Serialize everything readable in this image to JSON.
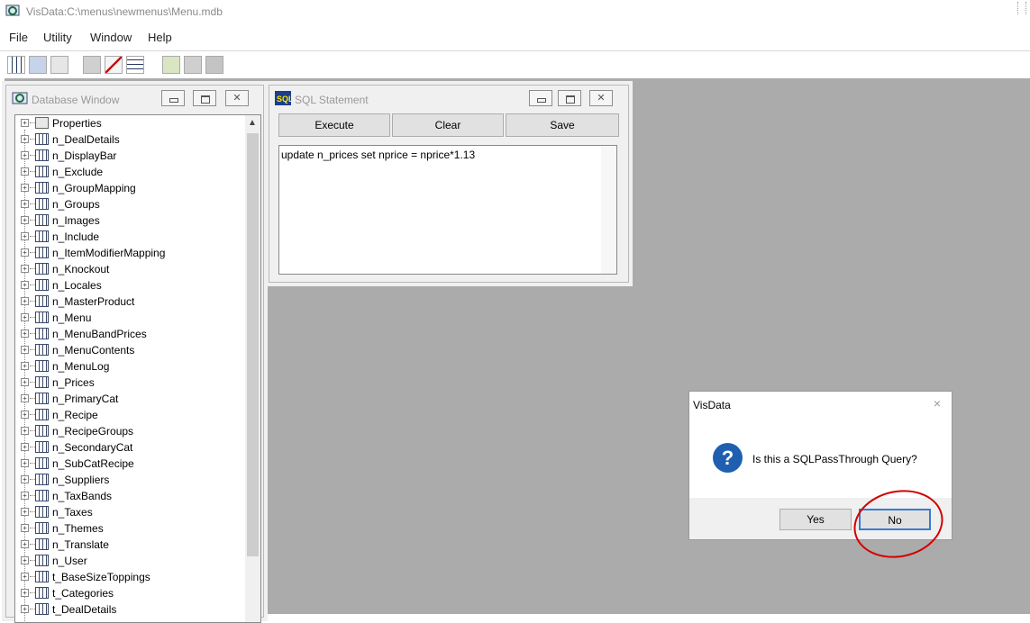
{
  "app": {
    "title": "VisData:C:\\menus\\newmenus\\Menu.mdb"
  },
  "menu": [
    "File",
    "Utility",
    "Window",
    "Help"
  ],
  "database_window": {
    "title": "Database Window",
    "items": [
      "Properties",
      "n_DealDetails",
      "n_DisplayBar",
      "n_Exclude",
      "n_GroupMapping",
      "n_Groups",
      "n_Images",
      "n_Include",
      "n_ItemModifierMapping",
      "n_Knockout",
      "n_Locales",
      "n_MasterProduct",
      "n_Menu",
      "n_MenuBandPrices",
      "n_MenuContents",
      "n_MenuLog",
      "n_Prices",
      "n_PrimaryCat",
      "n_Recipe",
      "n_RecipeGroups",
      "n_SecondaryCat",
      "n_SubCatRecipe",
      "n_Suppliers",
      "n_TaxBands",
      "n_Taxes",
      "n_Themes",
      "n_Translate",
      "n_User",
      "t_BaseSizeToppings",
      "t_Categories",
      "t_DealDetails"
    ]
  },
  "sql_window": {
    "title": "SQL Statement",
    "execute": "Execute",
    "clear": "Clear",
    "save": "Save",
    "query": "update n_prices set nprice = nprice*1.13"
  },
  "dialog": {
    "title": "VisData",
    "close": "×",
    "message": "Is this a SQLPassThrough Query?",
    "yes": "Yes",
    "no": "No"
  },
  "colors": {
    "mdi_background": "#ababab",
    "annotation": "#d30000",
    "question_icon": "#1f5fb0"
  }
}
